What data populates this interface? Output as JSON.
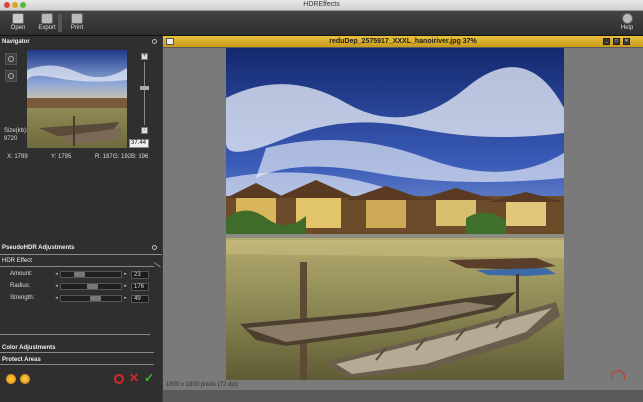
{
  "window": {
    "title": "HDREffects"
  },
  "toolbar": {
    "open_label": "Open",
    "export_label": "Export",
    "print_label": "Print",
    "help_label": "Help"
  },
  "navigator": {
    "title": "Navigator",
    "size_label": "Size(kb):",
    "size_value": "9720",
    "x_readout": "X: 1799",
    "y_readout": "Y: 1795",
    "r_readout": "R: 187",
    "g_readout": "G: 192",
    "b_readout": "B: 196",
    "zoom_value": "37.44"
  },
  "pseudohdr": {
    "title": "PseudoHDR Adjustments",
    "hdr_effect_label": "HDR Effect",
    "amount_label": "Amount:",
    "amount_value": "23",
    "radius_label": "Radius:",
    "radius_value": "176",
    "strength_label": "Strength:",
    "strength_value": "49"
  },
  "sections": {
    "color_adjustments": "Color Adjustments",
    "protect_areas": "Protect Areas"
  },
  "document": {
    "title": "reduDep_2575917_XXXL_hanoiriver.jpg 37%",
    "status": "1800 x 1800 pixels (72 dpi)"
  },
  "colors": {
    "doc_title_bar": "#d4a823",
    "accept_green": "#3dbb2c",
    "cancel_red": "#d22a2a"
  }
}
